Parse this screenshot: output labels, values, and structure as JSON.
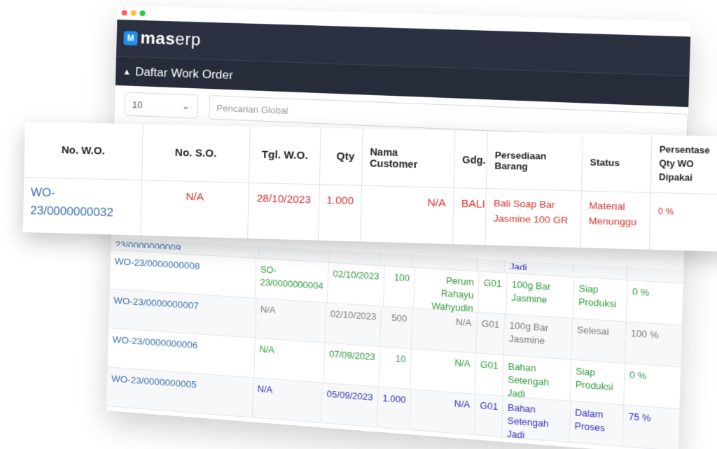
{
  "window": {
    "dot_colors": [
      "#ff5f57",
      "#febc2e",
      "#28c840"
    ]
  },
  "app": {
    "logo_letter": "M",
    "brand_bold": "mas",
    "brand_light": "erp",
    "page_title": "Daftar Work Order"
  },
  "toolbar": {
    "page_size": "10",
    "search_placeholder": "Pencarian Global"
  },
  "table": {
    "columns": [
      "No. W.O.",
      "No. S.O.",
      "Tgl. W.O.",
      "Qty",
      "Nama Customer",
      "Gdg.",
      "Persediaan Barang",
      "Status",
      "Persentase Qty WO Dipakai"
    ],
    "highlight_row": {
      "wo": "WO-23/0000000032",
      "so": "N/A",
      "date": "28/10/2023",
      "qty": "1.000",
      "customer": "N/A",
      "gdg": "BALI",
      "item": "Bali Soap Bar Jasmine 100 GR",
      "status": "Material Menunggu",
      "percent": "0 %",
      "color": "#d9302c"
    },
    "partial_row": {
      "wo": "23/0000000009",
      "item": "Jadi"
    },
    "rows": [
      {
        "wo": "WO-23/0000000008",
        "so": "SO-23/0000000004",
        "date": "02/10/2023",
        "qty": "100",
        "customer": "Perum Rahayu Wahyudin",
        "gdg": "G01",
        "item": "100g Bar Jasmine",
        "status": "Siap Produksi",
        "percent": "0 %",
        "color": "#2e9a3a"
      },
      {
        "wo": "WO-23/0000000007",
        "so": "N/A",
        "date": "02/10/2023",
        "qty": "500",
        "customer": "N/A",
        "gdg": "G01",
        "item": "100g Bar Jasmine",
        "status": "Selesai",
        "percent": "100 %",
        "color": "#7a7a7a"
      },
      {
        "wo": "WO-23/0000000006",
        "so": "N/A",
        "date": "07/09/2023",
        "qty": "10",
        "customer": "N/A",
        "gdg": "G01",
        "item": "Bahan Setengah Jadi",
        "status": "Siap Produksi",
        "percent": "0 %",
        "color": "#2e9a3a"
      },
      {
        "wo": "WO-23/0000000005",
        "so": "N/A",
        "date": "05/09/2023",
        "qty": "1.000",
        "customer": "N/A",
        "gdg": "G01",
        "item": "Bahan Setengah Jadi",
        "status": "Dalam Proses",
        "percent": "75 %",
        "color": "#2f2fc2"
      }
    ]
  }
}
